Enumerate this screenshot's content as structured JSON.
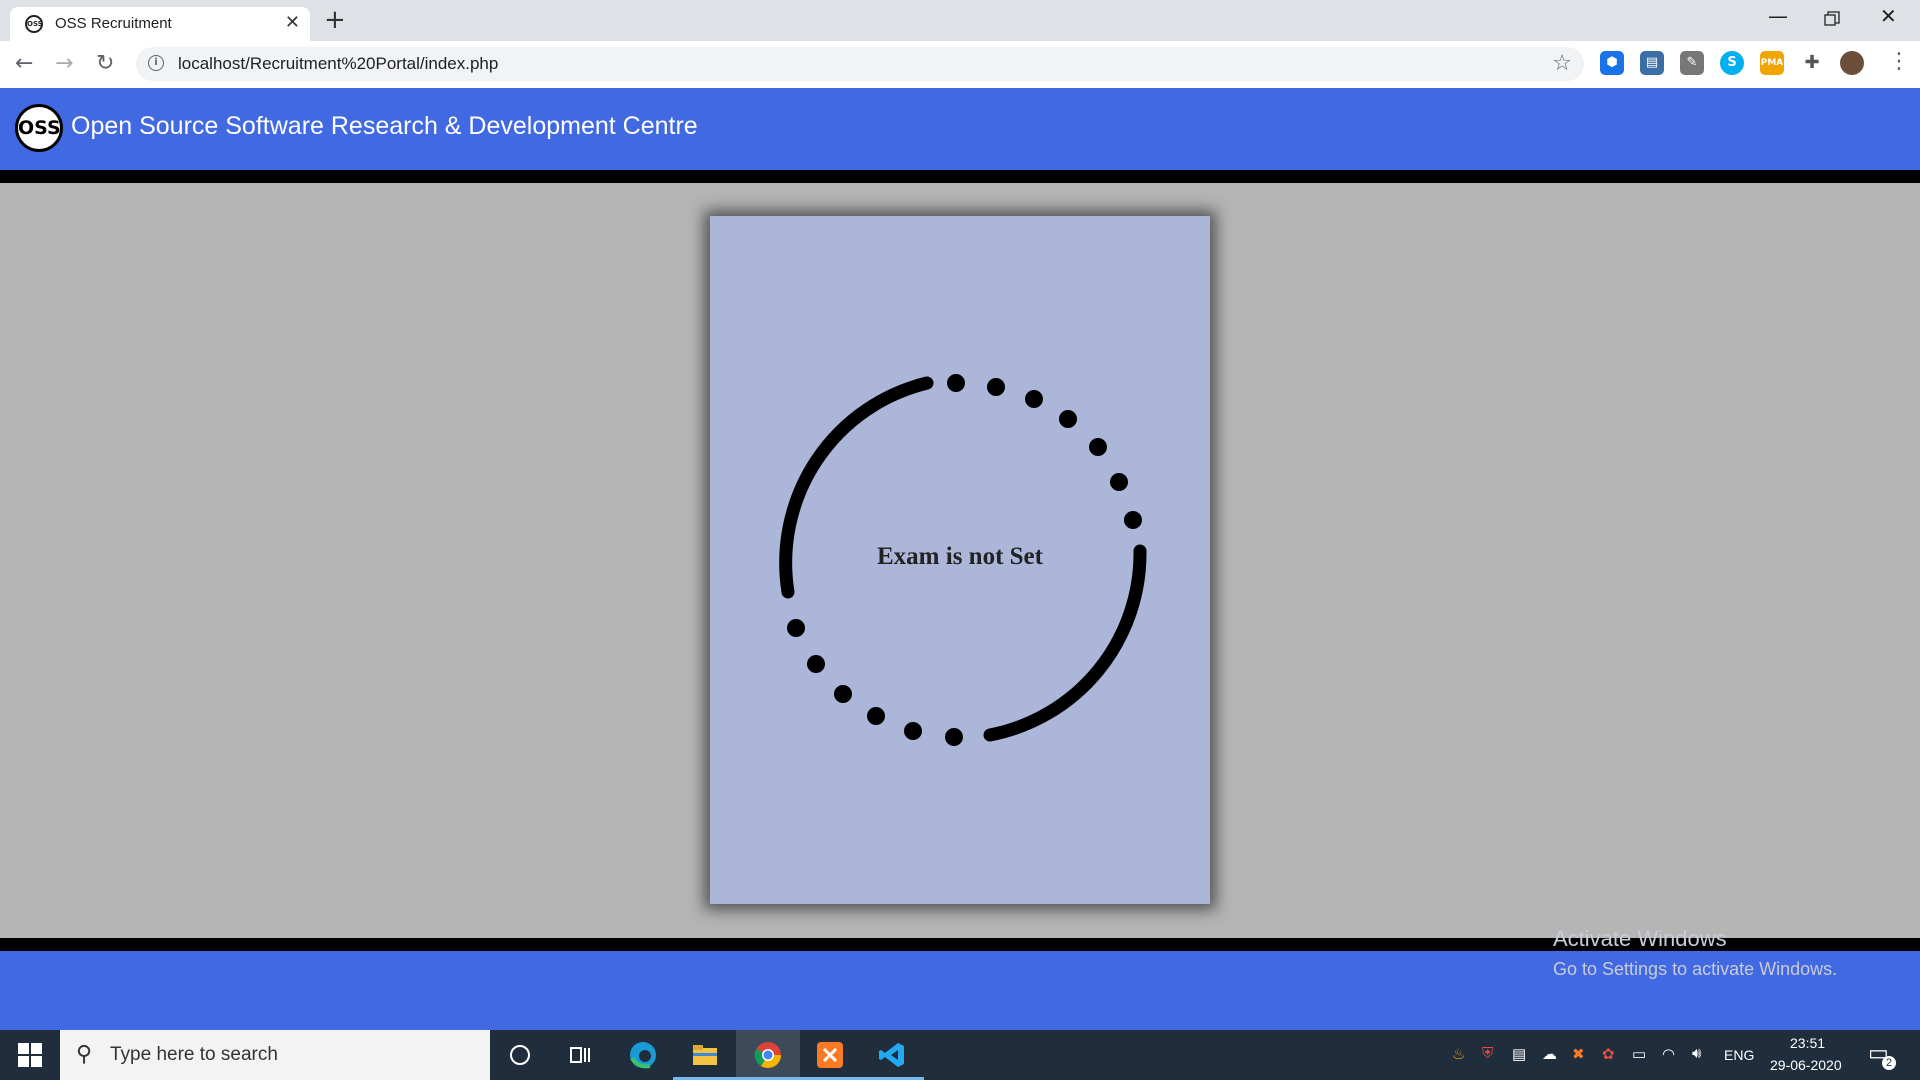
{
  "browser": {
    "tab_title": "OSS Recruitment",
    "favicon_text": "OSS",
    "new_tab_symbol": "+",
    "url": "localhost/Recruitment%20Portal/index.php",
    "extensions": [
      "extension-hexagon-icon",
      "extension-printer-icon",
      "eyedropper-icon",
      "skype-icon",
      "phpmyadmin-icon",
      "puzzle-icon",
      "profile-avatar"
    ]
  },
  "header": {
    "logo_text": "OSS",
    "title": "Open Source Software Research & Development Centre"
  },
  "main": {
    "message": "Exam is not Set"
  },
  "watermark": {
    "line1": "Activate Windows",
    "line2": "Go to Settings to activate Windows."
  },
  "taskbar": {
    "search_placeholder": "Type here to search",
    "language": "ENG",
    "time": "23:51",
    "date": "29-06-2020",
    "notification_count": "2"
  },
  "colors": {
    "header": "#4169e1",
    "card": "#abb6d9",
    "page_bg": "#b5b5b5"
  }
}
